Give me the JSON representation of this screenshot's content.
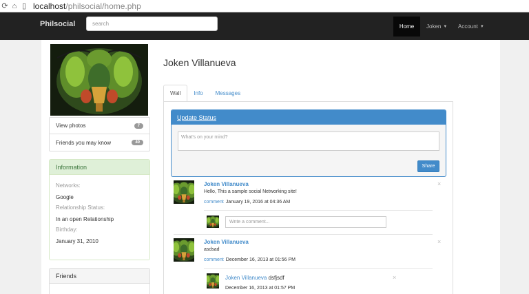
{
  "browser": {
    "url_host": "localhost",
    "url_path": "/philsocial/home.php"
  },
  "navbar": {
    "brand": "Philsocial",
    "search_placeholder": "search",
    "home": "Home",
    "user": "Joken",
    "account": "Account"
  },
  "sidebar": {
    "items": [
      {
        "label": "View photos",
        "count": "7"
      },
      {
        "label": "Friends you may know",
        "count": "40"
      }
    ],
    "info_title": "Information",
    "info": [
      {
        "label": "Networks:",
        "value": "Google"
      },
      {
        "label": "Relationship Status:",
        "value": "In an open Relationship"
      },
      {
        "label": "Birthday:",
        "value": "January 31, 2010"
      }
    ],
    "friends_title": "Friends"
  },
  "profile": {
    "name": "Joken Villanueva"
  },
  "tabs": [
    {
      "label": "Wall",
      "active": true
    },
    {
      "label": "Info",
      "active": false
    },
    {
      "label": "Messages",
      "active": false
    }
  ],
  "status": {
    "title": "Update Status",
    "placeholder": "What's on your mind?",
    "share": "Share"
  },
  "posts": [
    {
      "author": "Joken Villanueva",
      "text": "Hello, This a sample social Networking site!",
      "comment_link": "comment",
      "date": "January 19, 2016 at 04:36 AM",
      "comment_placeholder": "Write a comment..."
    },
    {
      "author": "Joken Villanueva",
      "text": "asdsad",
      "comment_link": "comment",
      "date": "December 16, 2013 at 01:56 PM",
      "reply": {
        "author": "Joken Villanueva",
        "text": "dsfjsdf",
        "date": "December 16, 2013 at 01:57 PM"
      }
    }
  ],
  "icons": {
    "reload": "reload-icon",
    "home": "home-icon",
    "page": "page-icon",
    "close": "×"
  },
  "colors": {
    "navbar": "#222222",
    "primary": "#428bca",
    "info_header": "#dff0d8"
  }
}
